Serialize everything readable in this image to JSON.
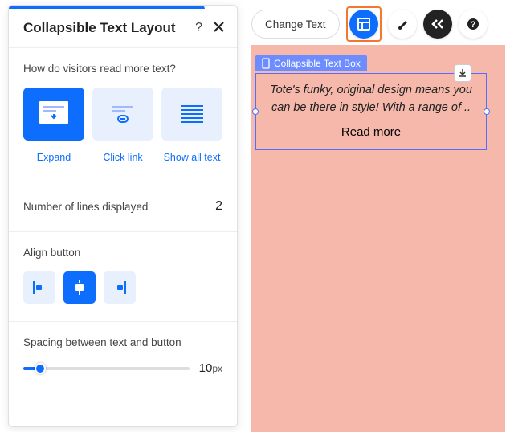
{
  "panel": {
    "title": "Collapsible Text Layout",
    "help": "?",
    "readQuestion": "How do visitors read more text?",
    "options": [
      {
        "label": "Expand"
      },
      {
        "label": "Click link"
      },
      {
        "label": "Show all text"
      }
    ],
    "linesLabel": "Number of lines displayed",
    "linesValue": "2",
    "alignLabel": "Align button",
    "spacingLabel": "Spacing between text and button",
    "spacingValue": "10",
    "spacingUnit": "px"
  },
  "toolbar": {
    "changeText": "Change Text"
  },
  "widget": {
    "tag": "Collapsible Text Box",
    "text": "Tote's funky, original design means you can be there in style! With a range of ..",
    "readMore": "Read more"
  }
}
